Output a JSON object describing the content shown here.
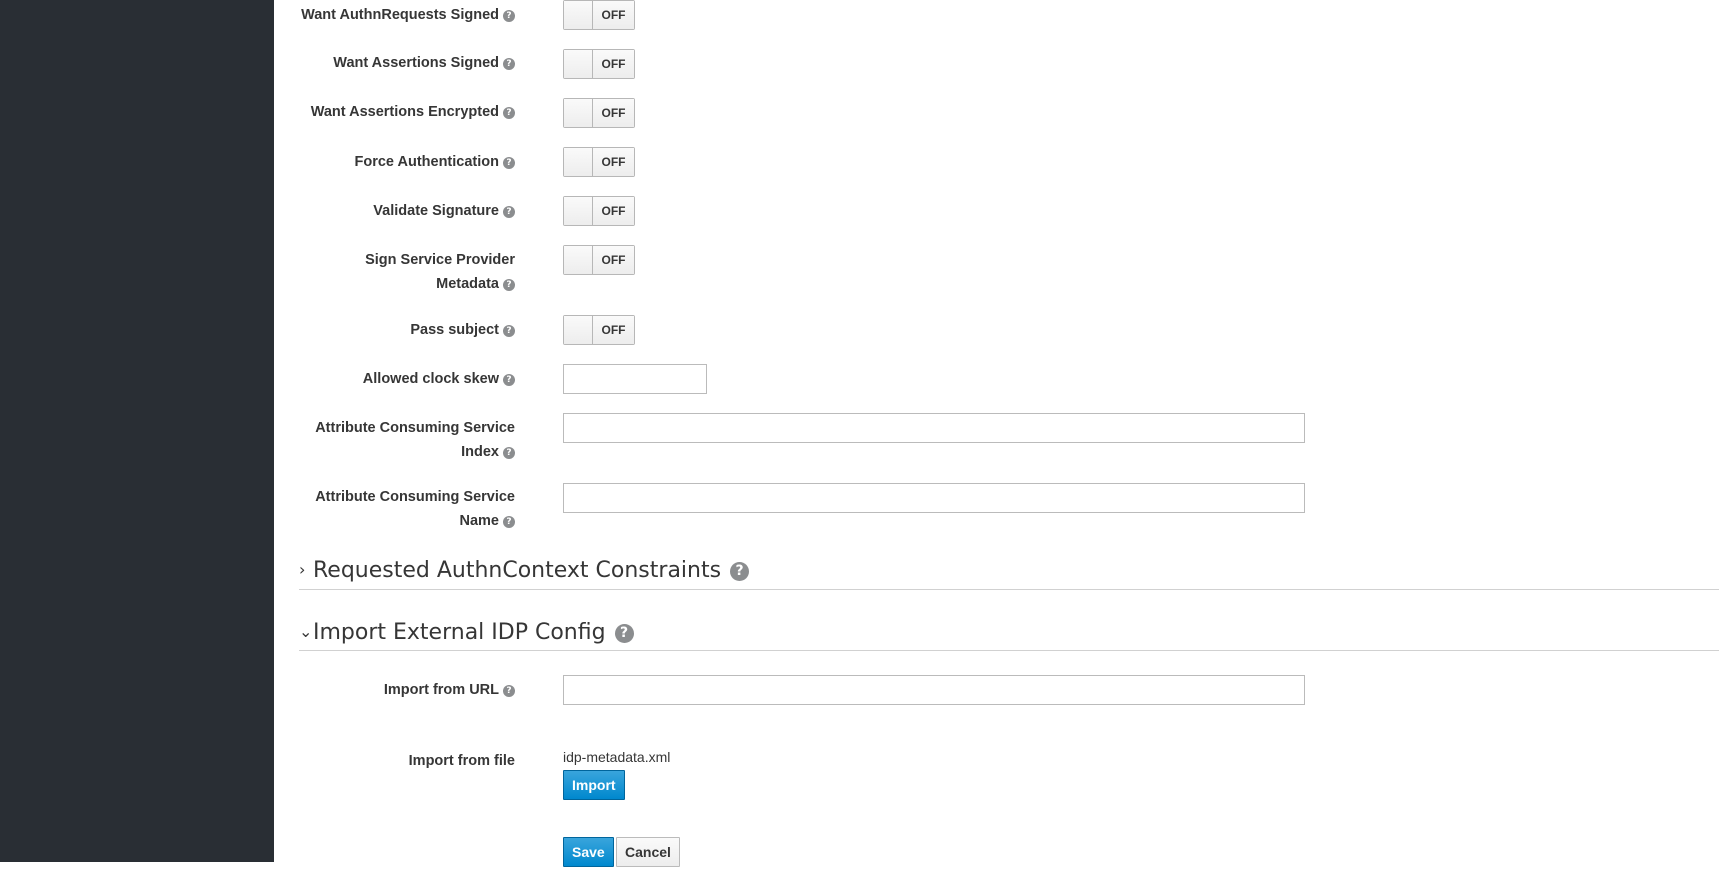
{
  "form": {
    "want_authn_requests_signed": {
      "label": "Want AuthnRequests Signed",
      "state": "OFF"
    },
    "want_assertions_signed": {
      "label": "Want Assertions Signed",
      "state": "OFF"
    },
    "want_assertions_encrypted": {
      "label": "Want Assertions Encrypted",
      "state": "OFF"
    },
    "force_authentication": {
      "label": "Force Authentication",
      "state": "OFF"
    },
    "validate_signature": {
      "label": "Validate Signature",
      "state": "OFF"
    },
    "sign_sp_metadata": {
      "label_line1": "Sign Service Provider",
      "label_line2": "Metadata",
      "state": "OFF"
    },
    "pass_subject": {
      "label": "Pass subject",
      "state": "OFF"
    },
    "allowed_clock_skew": {
      "label": "Allowed clock skew",
      "value": ""
    },
    "acs_index": {
      "label_line1": "Attribute Consuming Service",
      "label_line2": "Index",
      "value": ""
    },
    "acs_name": {
      "label_line1": "Attribute Consuming Service",
      "label_line2": "Name",
      "value": ""
    }
  },
  "sections": {
    "requested_authn": {
      "title": "Requested AuthnContext Constraints",
      "expanded": false
    },
    "import_idp": {
      "title": "Import External IDP Config",
      "expanded": true
    }
  },
  "import": {
    "url_label": "Import from URL",
    "url_value": "",
    "file_label": "Import from file",
    "file_name": "idp-metadata.xml",
    "import_button": "Import"
  },
  "actions": {
    "save": "Save",
    "cancel": "Cancel"
  },
  "icons": {
    "help": "?",
    "collapsed": "›",
    "expanded": "⌄"
  }
}
